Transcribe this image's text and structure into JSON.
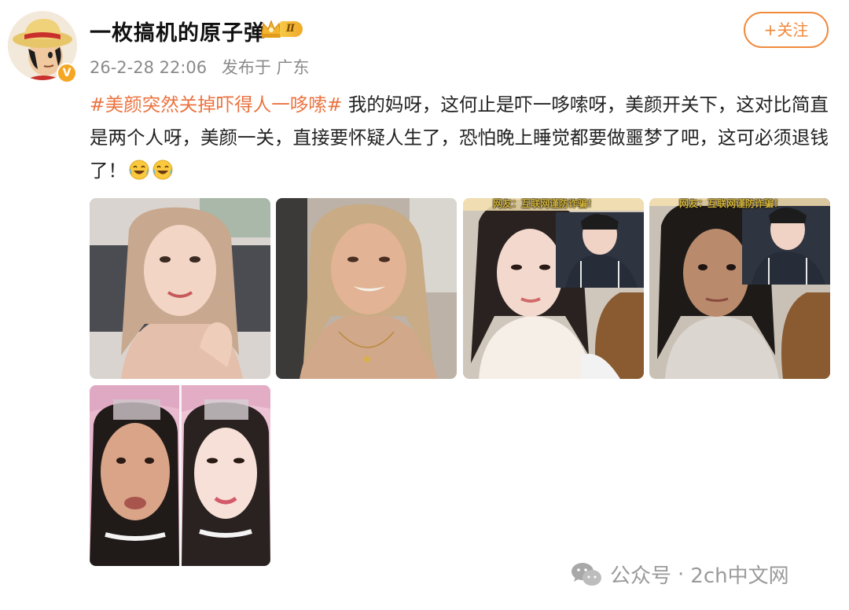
{
  "author": {
    "name": "一枚搞机的原子弹",
    "verified_mark": "V",
    "level_badge": "Ⅱ",
    "timestamp": "26-2-28 22:06",
    "location": "发布于 广东"
  },
  "follow_button": {
    "label": "+关注"
  },
  "post": {
    "hashtag": "#美颜突然关掉吓得人一哆嗦#",
    "body": " 我的妈呀，这何止是吓一哆嗦呀，美颜开关下，这对比简直是两个人呀，美颜一关，直接要怀疑人生了，恐怕晚上睡觉都要做噩梦了吧，这可必须退钱了！",
    "emojis": [
      "laughing-crying-emoji",
      "laughing-crying-emoji"
    ]
  },
  "photos": [
    {
      "name": "photo-1",
      "caption": ""
    },
    {
      "name": "photo-2",
      "caption": ""
    },
    {
      "name": "photo-3",
      "caption": "网友：互联网谨防诈骗！"
    },
    {
      "name": "photo-4",
      "caption": "网友：互联网谨防诈骗！"
    },
    {
      "name": "photo-5",
      "caption": ""
    }
  ],
  "watermark": {
    "icon": "wechat-icon",
    "left_text": "公众号",
    "separator": "·",
    "right_text": "2ch中文网"
  },
  "colors": {
    "accent": "#eb7340",
    "follow": "#f08a3c",
    "meta": "#8a8a8a",
    "badge": "#f5a623"
  }
}
